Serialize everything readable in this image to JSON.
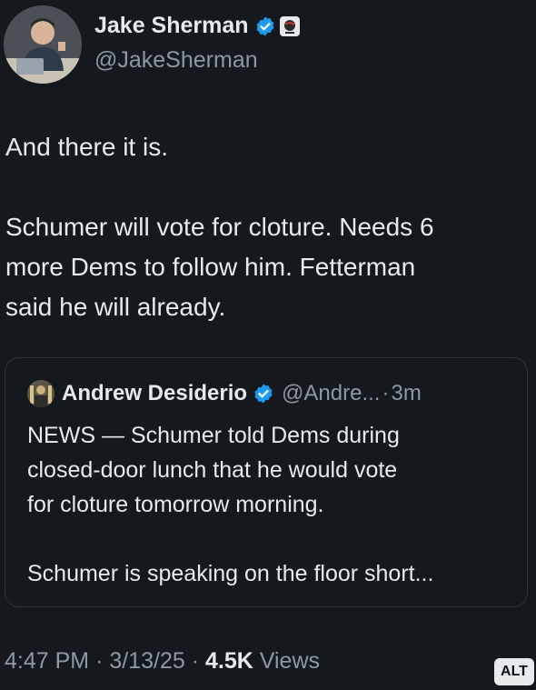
{
  "author": {
    "name": "Jake Sherman",
    "handle": "@JakeSherman",
    "avatar": "person-avatar",
    "verified_icon": "verified-badge-icon",
    "org_icon": "affiliate-org-icon"
  },
  "tweet": {
    "line1": "And there it is.",
    "line2": "Schumer will vote for cloture. Needs 6",
    "line3": "more Dems to follow him. Fetterman",
    "line4": "said he will already."
  },
  "quote": {
    "name": "Andrew Desiderio",
    "handle": "@Andre...",
    "time": "3m",
    "sep": "·",
    "line1": "NEWS — Schumer told Dems during",
    "line2": "closed-door lunch that he would vote",
    "line3": "for cloture tomorrow morning.",
    "line4": "Schumer is speaking on the floor short..."
  },
  "meta": {
    "time": "4:47 PM",
    "date": "3/13/25",
    "views_count": "4.5K",
    "views_label": "Views",
    "sep": "·"
  },
  "alt_label": "ALT",
  "colors": {
    "background": "#15191e",
    "text": "#e7e9ea",
    "muted": "#8b98a5",
    "verified": "#1d9bf0"
  }
}
